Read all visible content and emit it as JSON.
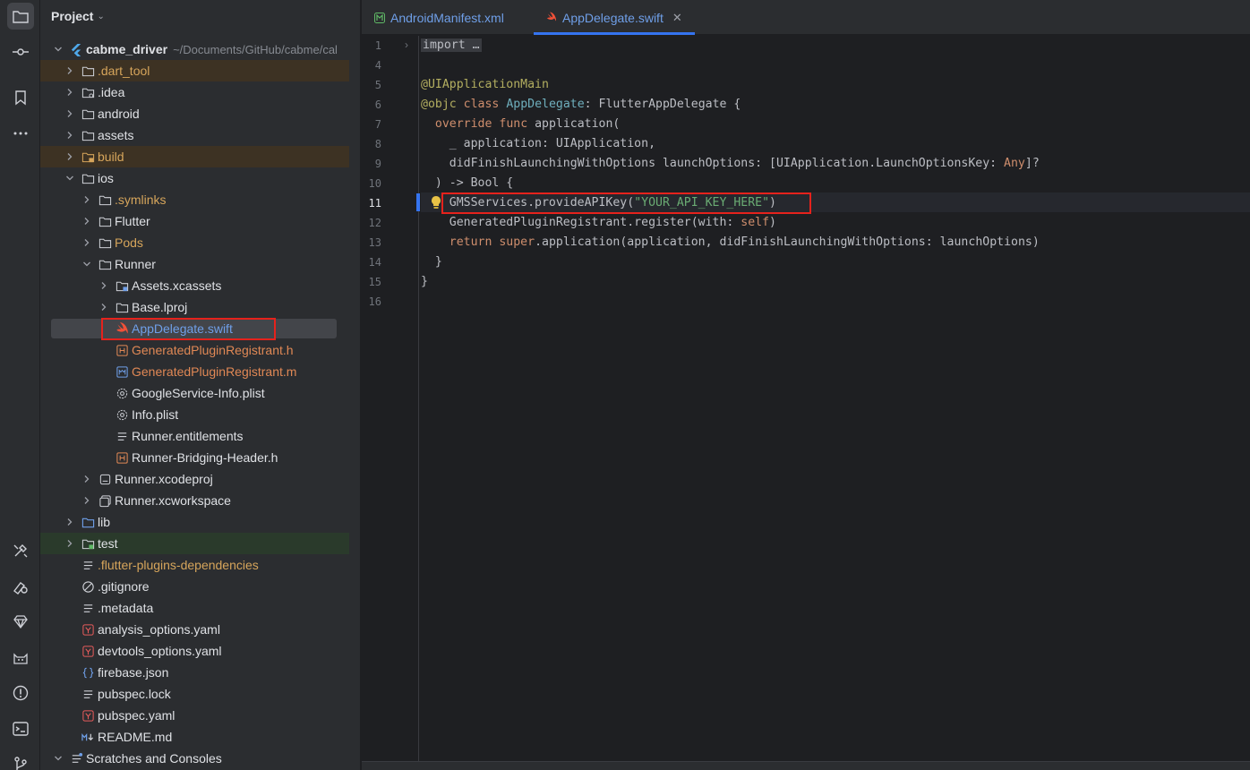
{
  "sidebar": {
    "icons": [
      "folder-icon",
      "commit-icon",
      "bookmark-icon",
      "more-icon",
      "build-icon",
      "flutter-inspector-icon",
      "gem-icon",
      "cat-icon",
      "problems-icon",
      "terminal-icon",
      "git-icon"
    ]
  },
  "project": {
    "title": "Project",
    "tree": [
      {
        "label": "cabme_driver",
        "path": "~/Documents/GitHub/cabme/cal",
        "depth": 0,
        "expanded": true,
        "icon": "flutter-module-icon",
        "style": "bold"
      },
      {
        "label": ".dart_tool",
        "depth": 1,
        "expanded": false,
        "icon": "folder-icon",
        "style": "orange",
        "row": "excluded"
      },
      {
        "label": ".idea",
        "depth": 1,
        "expanded": false,
        "icon": "folder-settings-icon",
        "style": "normal"
      },
      {
        "label": "android",
        "depth": 1,
        "expanded": false,
        "icon": "folder-icon",
        "style": "normal"
      },
      {
        "label": "assets",
        "depth": 1,
        "expanded": false,
        "icon": "folder-icon",
        "style": "normal"
      },
      {
        "label": "build",
        "depth": 1,
        "expanded": false,
        "icon": "folder-excluded-icon",
        "style": "orange",
        "row": "excluded"
      },
      {
        "label": "ios",
        "depth": 1,
        "expanded": true,
        "icon": "folder-icon",
        "style": "normal"
      },
      {
        "label": ".symlinks",
        "depth": 2,
        "expanded": false,
        "icon": "folder-icon",
        "style": "orange"
      },
      {
        "label": "Flutter",
        "depth": 2,
        "expanded": false,
        "icon": "folder-icon",
        "style": "normal"
      },
      {
        "label": "Pods",
        "depth": 2,
        "expanded": false,
        "icon": "folder-icon",
        "style": "orange"
      },
      {
        "label": "Runner",
        "depth": 2,
        "expanded": true,
        "icon": "folder-icon",
        "style": "normal"
      },
      {
        "label": "Assets.xcassets",
        "depth": 3,
        "expanded": false,
        "icon": "folder-assets-icon",
        "style": "normal"
      },
      {
        "label": "Base.lproj",
        "depth": 3,
        "expanded": false,
        "icon": "folder-icon",
        "style": "normal"
      },
      {
        "label": "AppDelegate.swift",
        "depth": 3,
        "icon": "swift-icon",
        "style": "blue",
        "row": "selected"
      },
      {
        "label": "GeneratedPluginRegistrant.h",
        "depth": 3,
        "icon": "header-file-icon",
        "style": "orangebright"
      },
      {
        "label": "GeneratedPluginRegistrant.m",
        "depth": 3,
        "icon": "objc-file-icon",
        "style": "orangebright"
      },
      {
        "label": "GoogleService-Info.plist",
        "depth": 3,
        "icon": "plist-gear-icon",
        "style": "normal"
      },
      {
        "label": "Info.plist",
        "depth": 3,
        "icon": "plist-gear-icon",
        "style": "normal"
      },
      {
        "label": "Runner.entitlements",
        "depth": 3,
        "icon": "text-file-icon",
        "style": "normal"
      },
      {
        "label": "Runner-Bridging-Header.h",
        "depth": 3,
        "icon": "header-file-icon",
        "style": "normal"
      },
      {
        "label": "Runner.xcodeproj",
        "depth": 2,
        "expanded": false,
        "icon": "xcodeproj-icon",
        "style": "normal"
      },
      {
        "label": "Runner.xcworkspace",
        "depth": 2,
        "expanded": false,
        "icon": "xcworkspace-icon",
        "style": "normal"
      },
      {
        "label": "lib",
        "depth": 1,
        "expanded": false,
        "icon": "folder-source-icon",
        "style": "normal"
      },
      {
        "label": "test",
        "depth": 1,
        "expanded": false,
        "icon": "folder-test-icon",
        "style": "normal",
        "row": "testroot"
      },
      {
        "label": ".flutter-plugins-dependencies",
        "depth": 1,
        "icon": "text-file-icon",
        "style": "orange"
      },
      {
        "label": ".gitignore",
        "depth": 1,
        "icon": "gitignore-icon",
        "style": "normal"
      },
      {
        "label": ".metadata",
        "depth": 1,
        "icon": "text-file-icon",
        "style": "normal"
      },
      {
        "label": "analysis_options.yaml",
        "depth": 1,
        "icon": "yaml-icon",
        "style": "normal"
      },
      {
        "label": "devtools_options.yaml",
        "depth": 1,
        "icon": "yaml-icon",
        "style": "normal"
      },
      {
        "label": "firebase.json",
        "depth": 1,
        "icon": "json-icon",
        "style": "normal"
      },
      {
        "label": "pubspec.lock",
        "depth": 1,
        "icon": "text-file-icon",
        "style": "normal"
      },
      {
        "label": "pubspec.yaml",
        "depth": 1,
        "icon": "yaml-icon",
        "style": "normal"
      },
      {
        "label": "README.md",
        "depth": 1,
        "icon": "markdown-icon",
        "style": "normal"
      },
      {
        "label": "Scratches and Consoles",
        "depth": 0,
        "expanded": true,
        "icon": "scratches-icon",
        "style": "normal"
      }
    ]
  },
  "tabs": [
    {
      "label": "AndroidManifest.xml",
      "icon": "manifest-icon",
      "active": false
    },
    {
      "label": "AppDelegate.swift",
      "icon": "swift-icon",
      "active": true,
      "close": "✕"
    }
  ],
  "editor": {
    "current_line": "11",
    "lines": [
      {
        "no": "1",
        "tokens": [
          {
            "t": "import …",
            "c": "fold"
          }
        ]
      },
      {
        "no": "4",
        "tokens": []
      },
      {
        "no": "5",
        "tokens": [
          {
            "t": "@UIApplicationMain",
            "c": "ann"
          }
        ]
      },
      {
        "no": "6",
        "tokens": [
          {
            "t": "@objc",
            "c": "ann"
          },
          {
            "t": " "
          },
          {
            "t": "class",
            "c": "kw"
          },
          {
            "t": " "
          },
          {
            "t": "AppDelegate",
            "c": "typ"
          },
          {
            "t": ": FlutterAppDelegate {"
          }
        ]
      },
      {
        "no": "7",
        "tokens": [
          {
            "t": "  "
          },
          {
            "t": "override",
            "c": "kw"
          },
          {
            "t": " "
          },
          {
            "t": "func",
            "c": "kw"
          },
          {
            "t": " application("
          }
        ]
      },
      {
        "no": "8",
        "tokens": [
          {
            "t": "    _ application: UIApplication,"
          }
        ]
      },
      {
        "no": "9",
        "tokens": [
          {
            "t": "    didFinishLaunchingWithOptions launchOptions: [UIApplication.LaunchOptionsKey: "
          },
          {
            "t": "Any",
            "c": "kw"
          },
          {
            "t": "]?"
          }
        ]
      },
      {
        "no": "10",
        "tokens": [
          {
            "t": "  ) -> Bool {"
          }
        ]
      },
      {
        "no": "11",
        "tokens": [
          {
            "t": "    GMSServices.provideAPIKey("
          },
          {
            "t": "\"YOUR_API_KEY_HERE\"",
            "c": "str"
          },
          {
            "t": ")"
          }
        ]
      },
      {
        "no": "12",
        "tokens": [
          {
            "t": "    GeneratedPluginRegistrant.register(with: "
          },
          {
            "t": "self",
            "c": "kw"
          },
          {
            "t": ")"
          }
        ]
      },
      {
        "no": "13",
        "tokens": [
          {
            "t": "    "
          },
          {
            "t": "return",
            "c": "kw"
          },
          {
            "t": " "
          },
          {
            "t": "super",
            "c": "kw"
          },
          {
            "t": ".application(application, didFinishLaunchingWithOptions: launchOptions)"
          }
        ]
      },
      {
        "no": "14",
        "tokens": [
          {
            "t": "  }"
          }
        ]
      },
      {
        "no": "15",
        "tokens": [
          {
            "t": "}"
          }
        ]
      },
      {
        "no": "16",
        "tokens": []
      }
    ]
  },
  "colors": {
    "accent": "#3574f0",
    "highlight_box": "#e5221c"
  }
}
